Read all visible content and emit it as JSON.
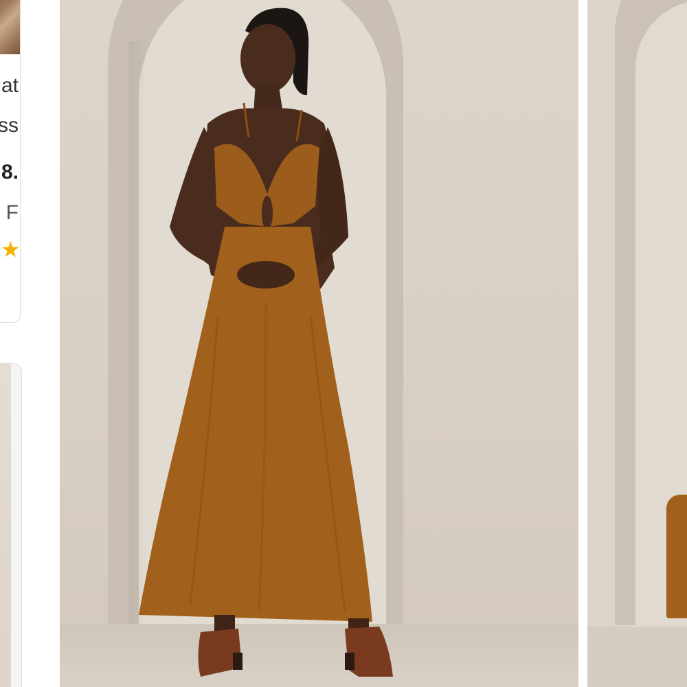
{
  "left_card": {
    "line1": "at",
    "line2": "ss",
    "price": "8.",
    "line4": "e F",
    "rating_star": "★"
  },
  "main_image": {
    "description_icon": "product-photo-icon"
  },
  "colors": {
    "dress": "#a2601d",
    "background": "#ddd5ca",
    "star": "#f5b301"
  }
}
